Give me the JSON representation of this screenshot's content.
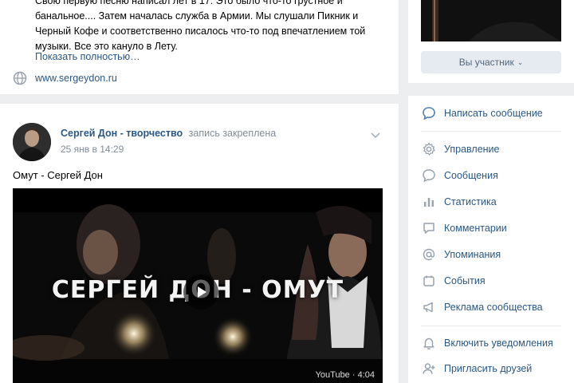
{
  "about": {
    "text": "Свою первую песню написал лет в 17. Это было что-то грустное и банальное.... Затем началась служба в Армии. Мы слушали Пикник и Черный Кофе и соответственно писалось что-то под впечатлением той музыки. Все это кануло в Лету.",
    "show_more": "Показать полностью…",
    "website": "www.sergeydon.ru"
  },
  "post": {
    "author": "Сергей Дон - творчество",
    "pinned_note": "запись закреплена",
    "date": "25 янв в 14:29",
    "title": "Омут - Сергей Дон",
    "video": {
      "title_text": "СЕРГЕЙ ДОН - ОМУТ",
      "badge": "YouTube · 4:04"
    }
  },
  "sidebar": {
    "participant_button": "Вы участник",
    "write_message": "Написать сообщение",
    "menu": [
      {
        "label": "Управление",
        "icon": "gear-icon"
      },
      {
        "label": "Сообщения",
        "icon": "message-icon"
      },
      {
        "label": "Статистика",
        "icon": "stats-icon"
      },
      {
        "label": "Комментарии",
        "icon": "comment-icon"
      },
      {
        "label": "Упоминания",
        "icon": "mention-icon"
      },
      {
        "label": "События",
        "icon": "calendar-icon"
      },
      {
        "label": "Реклама сообщества",
        "icon": "megaphone-icon"
      }
    ],
    "notifications": "Включить уведомления",
    "invite": "Пригласить друзей"
  },
  "colors": {
    "link": "#2a5885",
    "icon": "#99a2ad",
    "background": "#edeef0",
    "accent": "#5181b8"
  }
}
